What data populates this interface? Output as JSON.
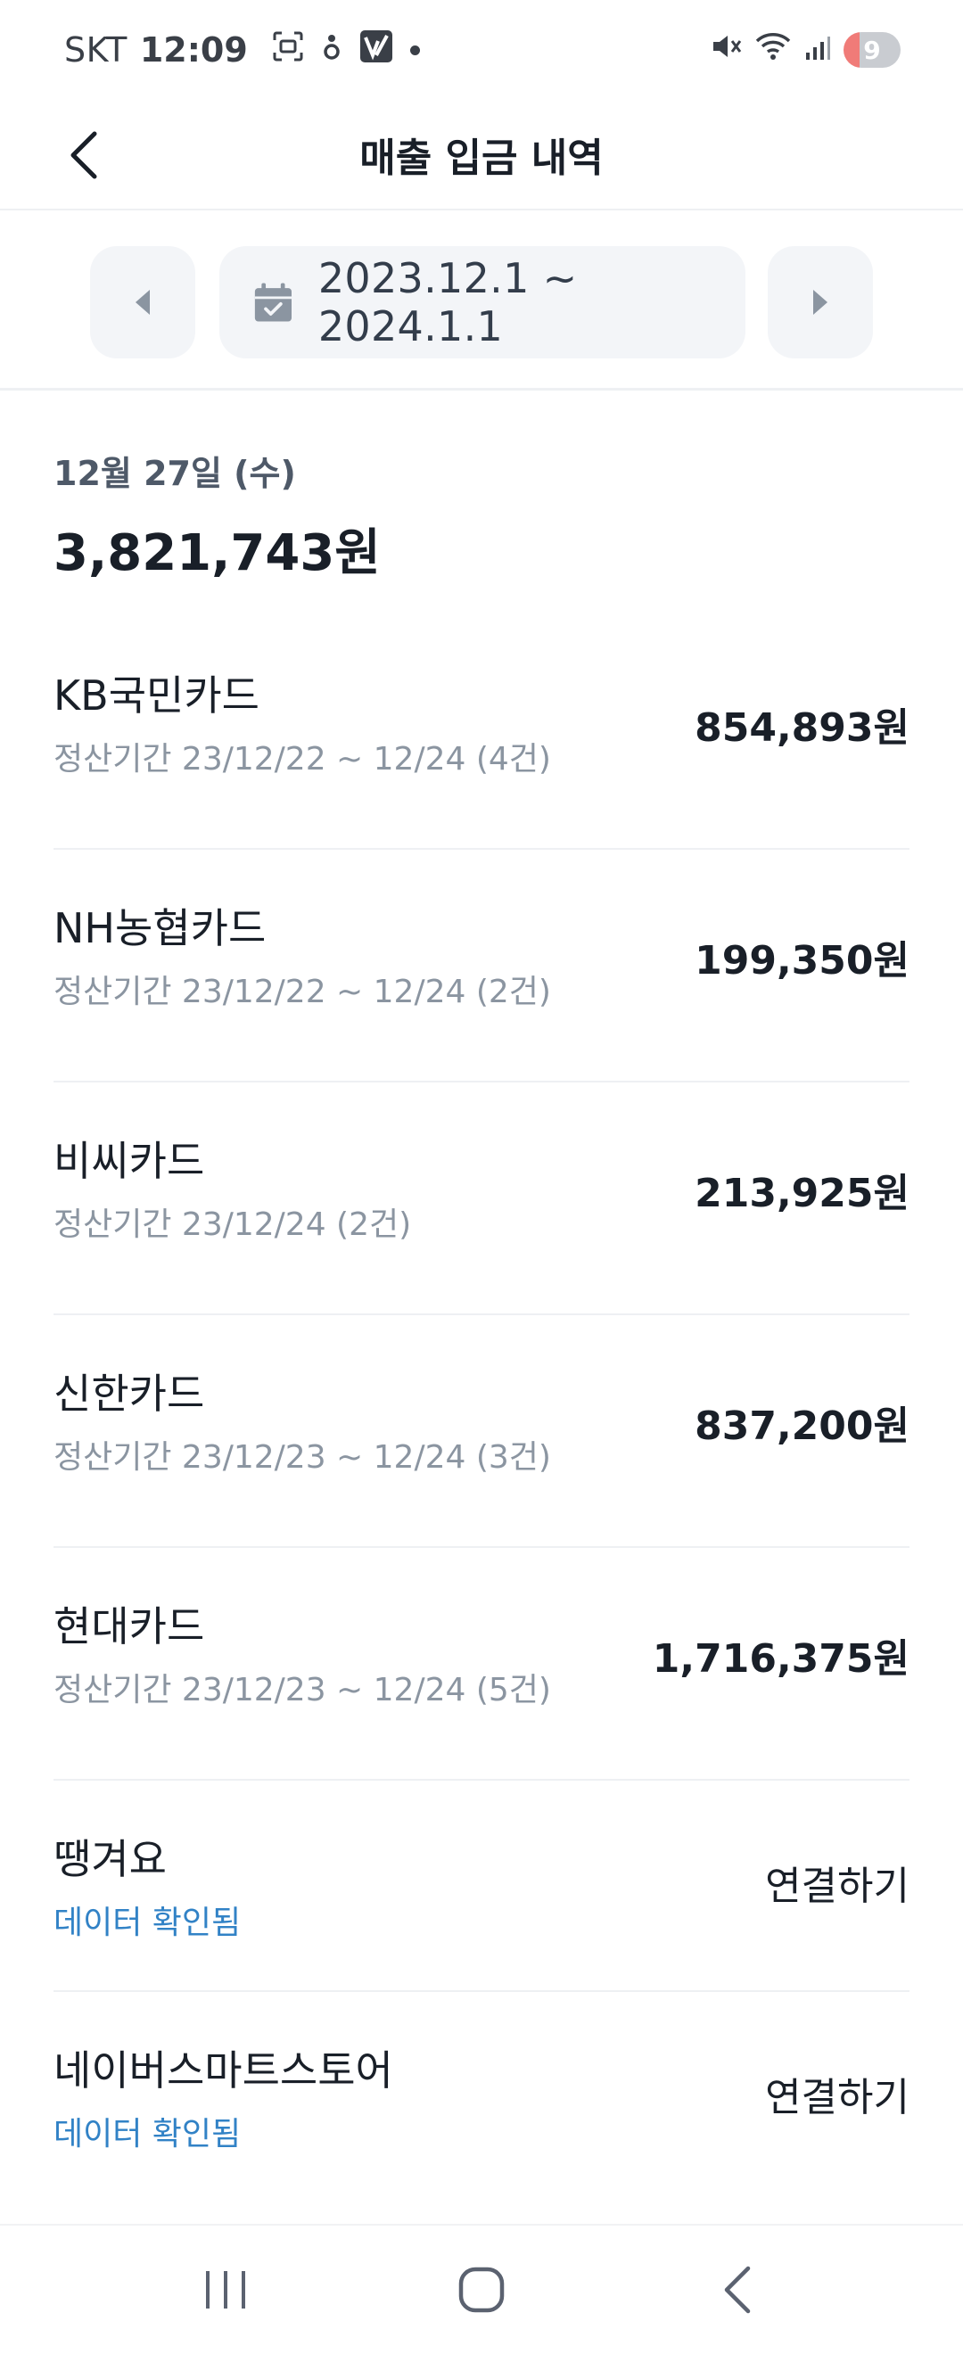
{
  "status_bar": {
    "carrier": "SKT",
    "time": "12:09",
    "battery_level": "9"
  },
  "header": {
    "title": "매출 입금 내역"
  },
  "date_selector": {
    "range": "2023.12.1 ~ 2024.1.1"
  },
  "summary": {
    "date": "12월 27일 (수)",
    "total": "3,821,743원"
  },
  "deposits": [
    {
      "name": "KB국민카드",
      "period": "정산기간 23/12/22 ~ 12/24 (4건)",
      "amount": "854,893원"
    },
    {
      "name": "NH농협카드",
      "period": "정산기간 23/12/22 ~ 12/24 (2건)",
      "amount": "199,350원"
    },
    {
      "name": "비씨카드",
      "period": "정산기간 23/12/24 (2건)",
      "amount": "213,925원"
    },
    {
      "name": "신한카드",
      "period": "정산기간 23/12/23 ~ 12/24 (3건)",
      "amount": "837,200원"
    },
    {
      "name": "현대카드",
      "period": "정산기간 23/12/23 ~ 12/24 (5건)",
      "amount": "1,716,375원"
    }
  ],
  "platforms": [
    {
      "name": "땡겨요",
      "status": "데이터 확인됨",
      "action": "연결하기"
    },
    {
      "name": "네이버스마트스토어",
      "status": "데이터 확인됨",
      "action": "연결하기"
    }
  ],
  "colors": {
    "confirmed_text": "#3182c6",
    "muted_text": "#8b95a1",
    "button_bg": "#f3f5f8"
  },
  "icons": {
    "back": "chevron-left-icon",
    "prev": "caret-left-icon",
    "next": "caret-right-icon",
    "calendar": "calendar-check-icon"
  }
}
